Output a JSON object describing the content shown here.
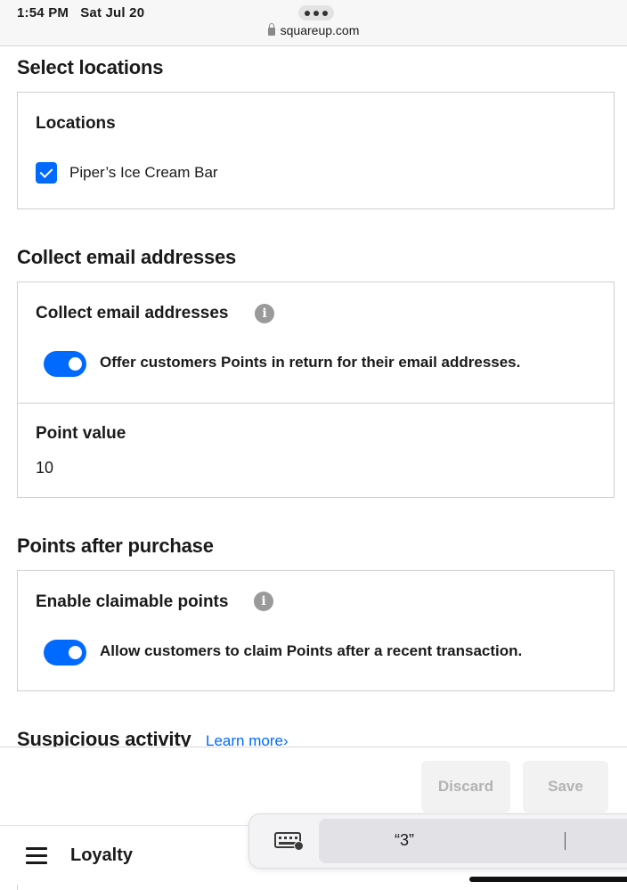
{
  "status_bar": {
    "time": "1:54 PM",
    "date": "Sat Jul 20",
    "url": "squareup.com"
  },
  "select_locations": {
    "heading": "Select locations",
    "card_title": "Locations",
    "location_label": "Piper’s Ice Cream Bar",
    "location_checked": true
  },
  "collect_email": {
    "heading": "Collect email addresses",
    "card_title": "Collect email addresses",
    "info_glyph": "i",
    "toggle_label": "Offer customers Points in return for their email addresses.",
    "toggle_on": true,
    "point_value_title": "Point value",
    "point_value": "10"
  },
  "points_after_purchase": {
    "heading": "Points after purchase",
    "card_title": "Enable claimable points",
    "info_glyph": "i",
    "toggle_label": "Allow customers to claim Points after a recent transaction.",
    "toggle_on": true
  },
  "suspicious_activity": {
    "heading": "Suspicious activity",
    "learn_more": "Learn more",
    "chevron": "›"
  },
  "actions": {
    "discard_label": "Discard",
    "save_label": "Save"
  },
  "footer": {
    "title": "Loyalty"
  },
  "keyboard_bar": {
    "suggestion": "“3”"
  },
  "colors": {
    "accent": "#006aff",
    "disabled_button_bg": "#f2f2f2",
    "disabled_button_text": "#b3b3b3"
  },
  "icons": [
    "lock-icon",
    "checkbox-checked-icon",
    "info-icon",
    "toggle-switch",
    "hamburger-icon",
    "keyboard-icon",
    "chevron-right-icon"
  ]
}
